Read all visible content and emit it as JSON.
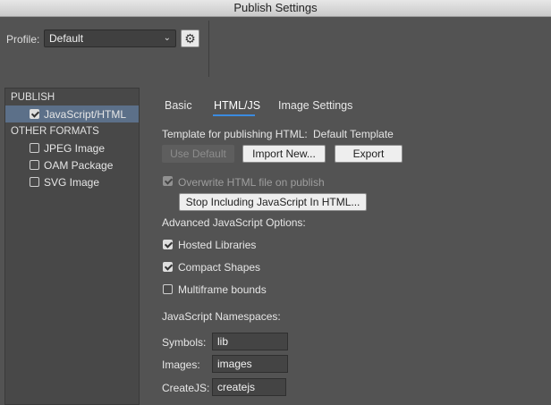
{
  "window": {
    "title": "Publish Settings"
  },
  "profile": {
    "label": "Profile:",
    "value": "Default",
    "settings_icon": "gear-icon"
  },
  "sidebar": {
    "publish_header": "PUBLISH",
    "publish_items": [
      {
        "label": "JavaScript/HTML",
        "checked": true,
        "selected": true
      }
    ],
    "other_header": "OTHER FORMATS",
    "other_items": [
      {
        "label": "JPEG Image",
        "checked": false
      },
      {
        "label": "OAM Package",
        "checked": false
      },
      {
        "label": "SVG Image",
        "checked": false
      }
    ]
  },
  "tabs": [
    {
      "label": "Basic",
      "active": false
    },
    {
      "label": "HTML/JS",
      "active": true
    },
    {
      "label": "Image Settings",
      "active": false
    }
  ],
  "html_js": {
    "template_label": "Template for publishing HTML:",
    "template_value": "Default Template",
    "use_default_label": "Use Default",
    "import_new_label": "Import New...",
    "export_label": "Export",
    "overwrite_label": "Overwrite HTML file on publish",
    "overwrite_checked": true,
    "stop_including_label": "Stop Including JavaScript In HTML...",
    "advanced_header": "Advanced JavaScript Options:",
    "options": [
      {
        "label": "Hosted Libraries",
        "checked": true
      },
      {
        "label": "Compact Shapes",
        "checked": true
      },
      {
        "label": "Multiframe bounds",
        "checked": false
      }
    ],
    "namespaces_header": "JavaScript Namespaces:",
    "namespaces": [
      {
        "label": "Symbols:",
        "value": "lib"
      },
      {
        "label": "Images:",
        "value": "images"
      },
      {
        "label": "CreateJS:",
        "value": "createjs"
      }
    ]
  },
  "colors": {
    "accent": "#3b8be0",
    "selection": "#5c7089",
    "background": "#535353"
  }
}
